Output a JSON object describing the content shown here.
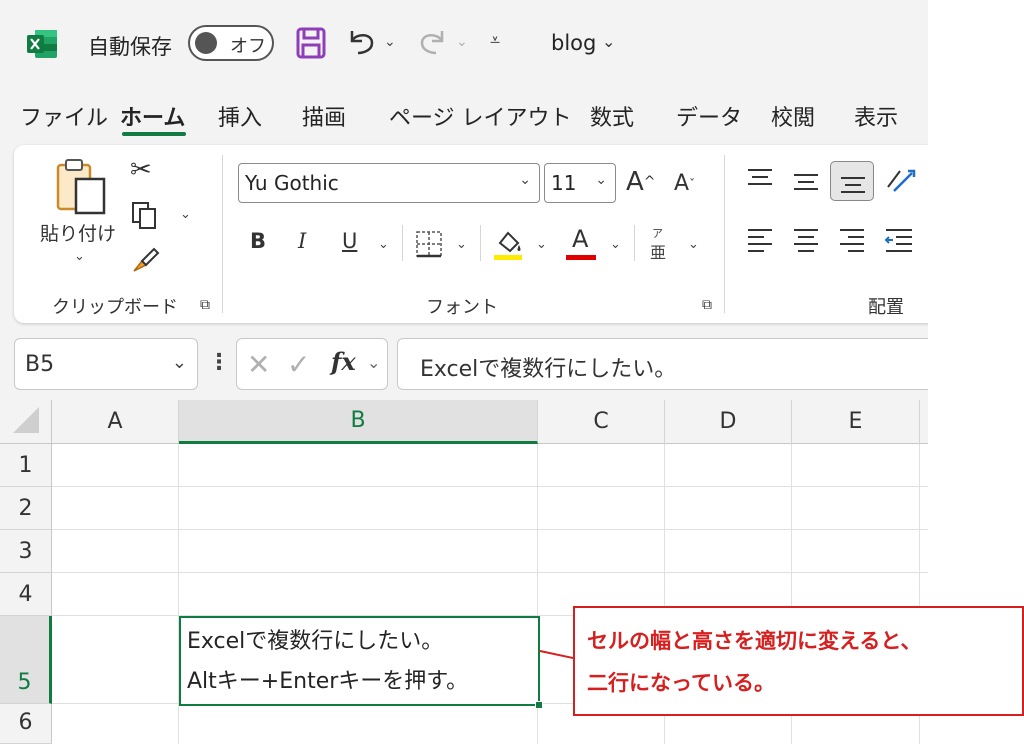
{
  "titlebar": {
    "autosave_label": "自動保存",
    "autosave_state": "オフ",
    "doc_name": "blog"
  },
  "tabs": [
    {
      "label": "ファイル"
    },
    {
      "label": "ホーム"
    },
    {
      "label": "挿入"
    },
    {
      "label": "描画"
    },
    {
      "label": "ページ レイアウト"
    },
    {
      "label": "数式"
    },
    {
      "label": "データ"
    },
    {
      "label": "校閲"
    },
    {
      "label": "表示"
    }
  ],
  "ribbon": {
    "clipboard": {
      "paste_label": "貼り付け",
      "group_label": "クリップボード"
    },
    "font": {
      "font_name": "Yu Gothic",
      "font_size": "11",
      "group_label": "フォント",
      "bold": "B",
      "italic": "I",
      "underline": "U",
      "phonetic_top": "ア",
      "phonetic_bottom": "亜",
      "grow": "A",
      "shrink": "A",
      "fontcolor": "A"
    },
    "alignment": {
      "group_label": "配置"
    }
  },
  "formula_bar": {
    "name_box": "B5",
    "fx": "fx",
    "content": "Excelで複数行にしたい。"
  },
  "grid": {
    "columns": [
      "A",
      "B",
      "C",
      "D",
      "E"
    ],
    "rows": [
      "1",
      "2",
      "3",
      "4",
      "5",
      "6"
    ],
    "cell_b5_line1": "Excelで複数行にしたい。",
    "cell_b5_line2": "Altキー+Enterキーを押す。"
  },
  "callout": {
    "line1": "セルの幅と高さを適切に変えると、",
    "line2": "二行になっている。"
  },
  "colors": {
    "accent": "#107c41",
    "callout": "#d62020",
    "save_icon": "#8e3fb8"
  }
}
